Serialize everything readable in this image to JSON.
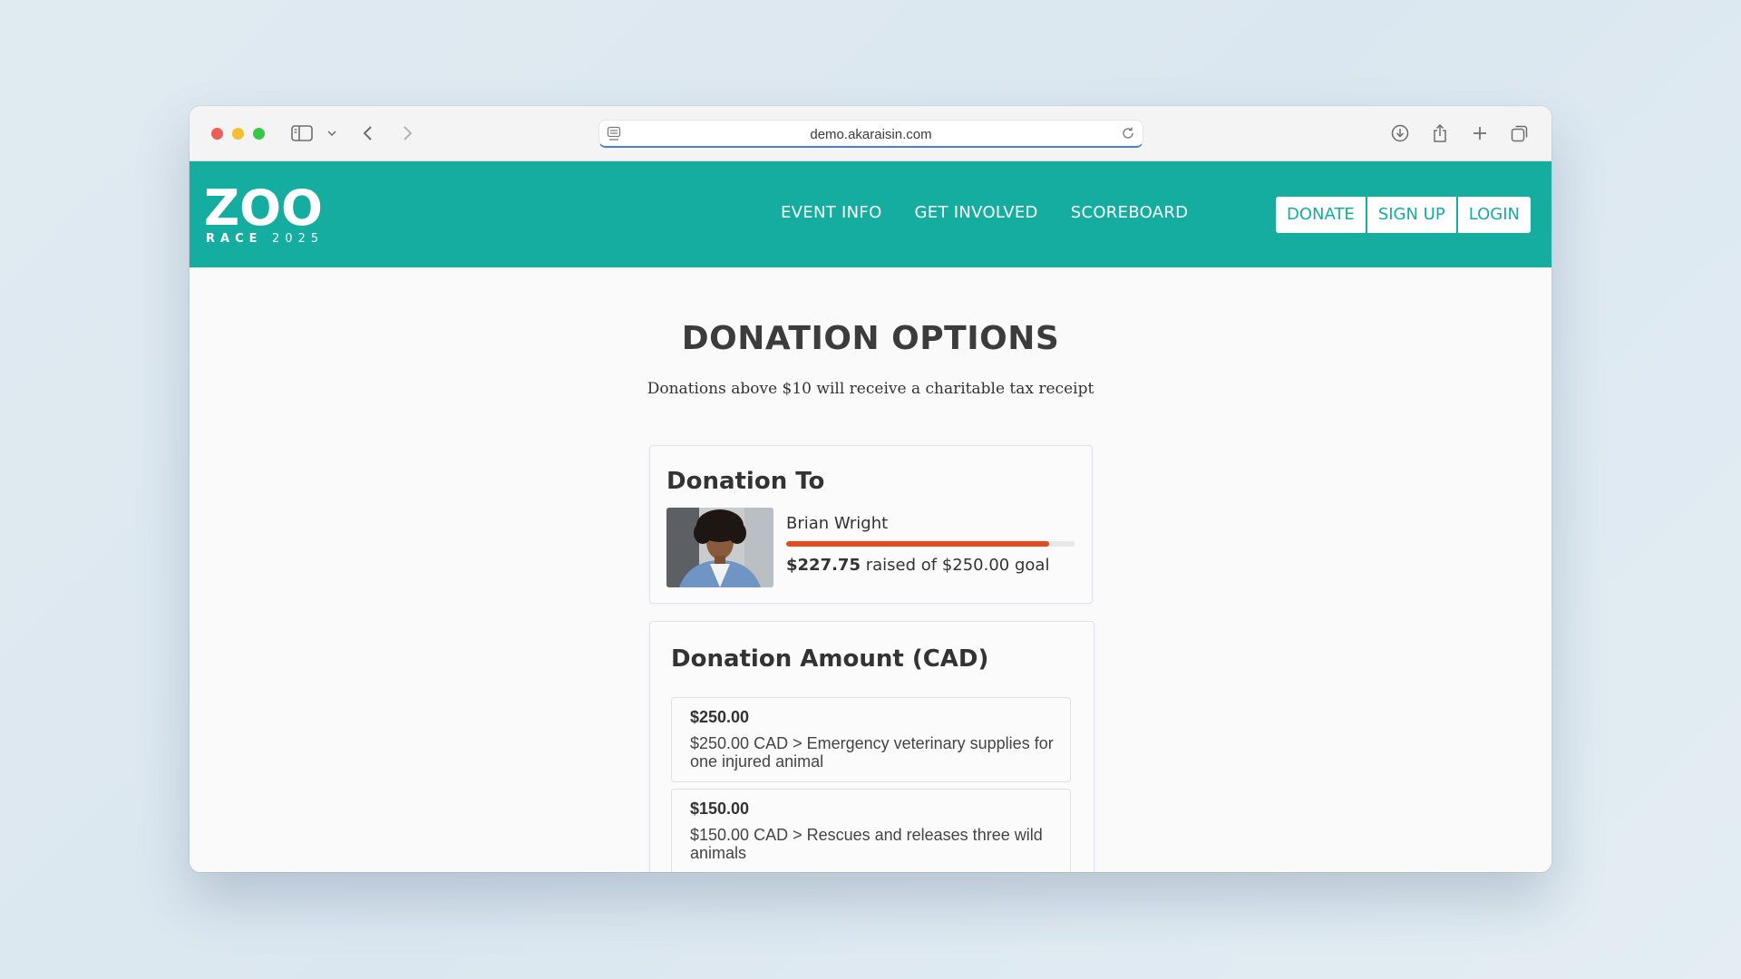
{
  "browser": {
    "url": "demo.akaraisin.com"
  },
  "header": {
    "logo_word": "ZOO",
    "logo_sub": "RACE",
    "logo_year": "2025",
    "nav": [
      "EVENT INFO",
      "GET INVOLVED",
      "SCOREBOARD"
    ],
    "auth": [
      "DONATE",
      "SIGN UP",
      "LOGIN"
    ]
  },
  "page": {
    "title": "DONATION OPTIONS",
    "subtitle": "Donations above $10 will receive a charitable tax receipt"
  },
  "donation_to": {
    "heading": "Donation To",
    "name": "Brian Wright",
    "raised": "$227.75",
    "raised_text": "raised of $250.00 goal",
    "progress_fraction": 0.911
  },
  "donation_amount": {
    "heading": "Donation Amount (CAD)",
    "options": [
      {
        "price": "$250.00",
        "desc": "$250.00 CAD > Emergency veterinary supplies for one injured animal"
      },
      {
        "price": "$150.00",
        "desc": "$150.00 CAD > Rescues and releases three wild animals"
      }
    ]
  },
  "colors": {
    "brand": "#14ad9f",
    "progress": "#e24c1f"
  },
  "icons": [
    "sidebar-icon",
    "chevron-down-icon",
    "back-icon",
    "forward-icon",
    "page-icon",
    "reload-icon",
    "download-icon",
    "share-icon",
    "new-tab-icon",
    "tabs-overview-icon"
  ]
}
